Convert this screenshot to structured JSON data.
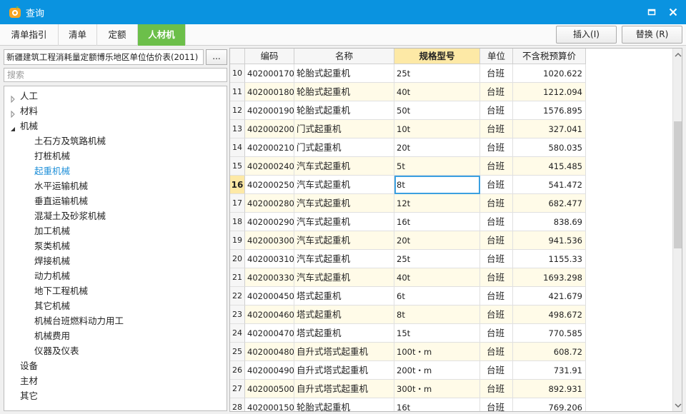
{
  "window": {
    "title": "查询"
  },
  "tabs": [
    {
      "label": "清单指引",
      "active": false
    },
    {
      "label": "清单",
      "active": false
    },
    {
      "label": "定额",
      "active": false
    },
    {
      "label": "人材机",
      "active": true
    }
  ],
  "actions": {
    "insert": "插入(I)",
    "replace": "替换 (R)"
  },
  "left": {
    "database": "新疆建筑工程消耗量定额博乐地区单位估价表(2011)",
    "more_label": "...",
    "search_placeholder": "搜索",
    "tree": [
      {
        "label": "人工",
        "level": 0,
        "arrow": "right"
      },
      {
        "label": "材料",
        "level": 0,
        "arrow": "right"
      },
      {
        "label": "机械",
        "level": 0,
        "arrow": "down"
      },
      {
        "label": "土石方及筑路机械",
        "level": 1
      },
      {
        "label": "打桩机械",
        "level": 1
      },
      {
        "label": "起重机械",
        "level": 1,
        "selected": true
      },
      {
        "label": "水平运输机械",
        "level": 1
      },
      {
        "label": "垂直运输机械",
        "level": 1
      },
      {
        "label": "混凝土及砂浆机械",
        "level": 1
      },
      {
        "label": "加工机械",
        "level": 1
      },
      {
        "label": "泵类机械",
        "level": 1
      },
      {
        "label": "焊接机械",
        "level": 1
      },
      {
        "label": "动力机械",
        "level": 1
      },
      {
        "label": "地下工程机械",
        "level": 1
      },
      {
        "label": "其它机械",
        "level": 1
      },
      {
        "label": "机械台班燃料动力用工",
        "level": 1
      },
      {
        "label": "机械费用",
        "level": 1
      },
      {
        "label": "仪器及仪表",
        "level": 1
      },
      {
        "label": "设备",
        "level": 0
      },
      {
        "label": "主材",
        "level": 0
      },
      {
        "label": "其它",
        "level": 0
      }
    ]
  },
  "table": {
    "columns": [
      "编码",
      "名称",
      "规格型号",
      "单位",
      "不含税预算价"
    ],
    "active_column": 2,
    "selected_row": 16,
    "rows": [
      {
        "n": "10",
        "code": "402000170",
        "name": "轮胎式起重机",
        "spec": "25t",
        "unit": "台班",
        "price": "1020.622"
      },
      {
        "n": "11",
        "code": "402000180",
        "name": "轮胎式起重机",
        "spec": "40t",
        "unit": "台班",
        "price": "1212.094"
      },
      {
        "n": "12",
        "code": "402000190",
        "name": "轮胎式起重机",
        "spec": "50t",
        "unit": "台班",
        "price": "1576.895"
      },
      {
        "n": "13",
        "code": "402000200",
        "name": "门式起重机",
        "spec": "10t",
        "unit": "台班",
        "price": "327.041"
      },
      {
        "n": "14",
        "code": "402000210",
        "name": "门式起重机",
        "spec": "20t",
        "unit": "台班",
        "price": "580.035"
      },
      {
        "n": "15",
        "code": "402000240",
        "name": "汽车式起重机",
        "spec": "5t",
        "unit": "台班",
        "price": "415.485"
      },
      {
        "n": "16",
        "code": "402000250",
        "name": "汽车式起重机",
        "spec": "8t",
        "unit": "台班",
        "price": "541.472"
      },
      {
        "n": "17",
        "code": "402000280",
        "name": "汽车式起重机",
        "spec": "12t",
        "unit": "台班",
        "price": "682.477"
      },
      {
        "n": "18",
        "code": "402000290",
        "name": "汽车式起重机",
        "spec": "16t",
        "unit": "台班",
        "price": "838.69"
      },
      {
        "n": "19",
        "code": "402000300",
        "name": "汽车式起重机",
        "spec": "20t",
        "unit": "台班",
        "price": "941.536"
      },
      {
        "n": "20",
        "code": "402000310",
        "name": "汽车式起重机",
        "spec": "25t",
        "unit": "台班",
        "price": "1155.33"
      },
      {
        "n": "21",
        "code": "402000330",
        "name": "汽车式起重机",
        "spec": "40t",
        "unit": "台班",
        "price": "1693.298"
      },
      {
        "n": "22",
        "code": "402000450",
        "name": "塔式起重机",
        "spec": "6t",
        "unit": "台班",
        "price": "421.679"
      },
      {
        "n": "23",
        "code": "402000460",
        "name": "塔式起重机",
        "spec": "8t",
        "unit": "台班",
        "price": "498.672"
      },
      {
        "n": "24",
        "code": "402000470",
        "name": "塔式起重机",
        "spec": "15t",
        "unit": "台班",
        "price": "770.585"
      },
      {
        "n": "25",
        "code": "402000480",
        "name": "自升式塔式起重机",
        "spec": "100t・m",
        "unit": "台班",
        "price": "608.72"
      },
      {
        "n": "26",
        "code": "402000490",
        "name": "自升式塔式起重机",
        "spec": "200t・m",
        "unit": "台班",
        "price": "731.91"
      },
      {
        "n": "27",
        "code": "402000500",
        "name": "自升式塔式起重机",
        "spec": "300t・m",
        "unit": "台班",
        "price": "892.931"
      },
      {
        "n": "28",
        "code": "402000150",
        "name": "轮胎式起重机",
        "spec": "16t",
        "unit": "台班",
        "price": "769.206"
      }
    ]
  },
  "colors": {
    "titlebar": "#0a93e0",
    "active_tab": "#6cbf4a",
    "active_header": "#fde9a6",
    "selected_tree": "#1e8fd8"
  },
  "icons": {
    "app": "app-logo-icon",
    "minimize": "minimize-icon",
    "close": "close-icon"
  }
}
